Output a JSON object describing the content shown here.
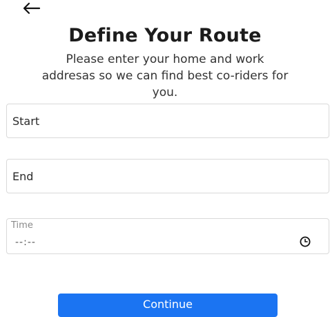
{
  "header": {
    "back_icon": "arrow-left-icon",
    "title": "Define Your Route",
    "subtitle": "Please enter your home and work\naddresas so we can find best co-riders for\nyou."
  },
  "form": {
    "start_placeholder": "Start",
    "end_placeholder": "End",
    "time_label": "Time",
    "time_value": "--:--",
    "time_icon": "clock-icon"
  },
  "actions": {
    "continue_label": "Continue"
  },
  "colors": {
    "accent": "#1b74f2"
  }
}
